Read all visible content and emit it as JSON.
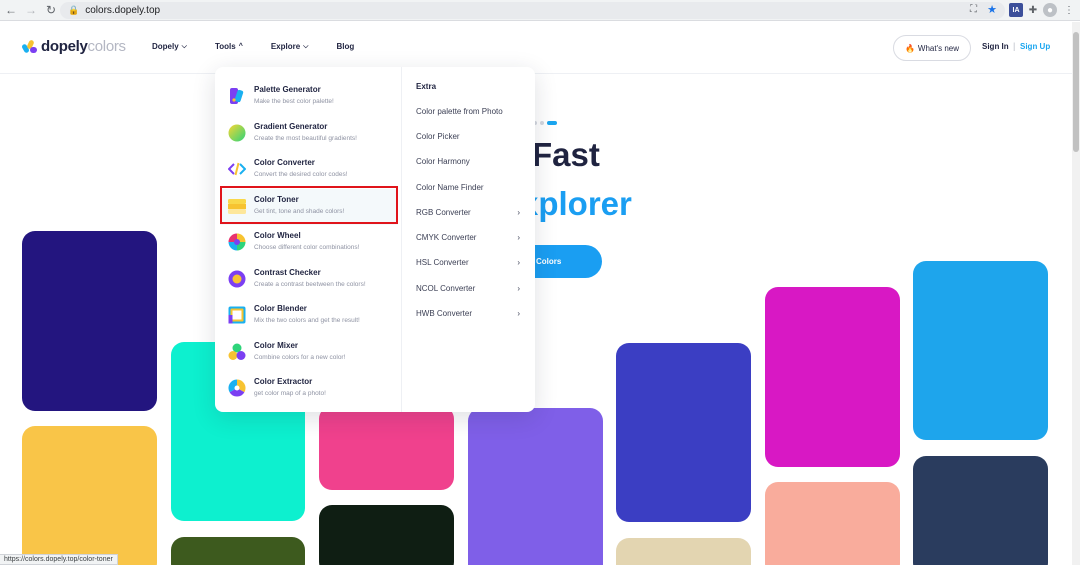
{
  "browser": {
    "url": "colors.dopely.top",
    "status_url": "https://colors.dopely.top/color-toner"
  },
  "header": {
    "logo_part1": "dopely",
    "logo_part2": "colors",
    "nav": [
      {
        "label": "Dopely",
        "chevron": "down"
      },
      {
        "label": "Tools",
        "chevron": "up"
      },
      {
        "label": "Explore",
        "chevron": "down"
      },
      {
        "label": "Blog"
      }
    ],
    "whats_new": "What's new",
    "sign_in": "Sign In",
    "separator": "|",
    "sign_up": "Sign Up"
  },
  "hero": {
    "line1": "r Fast",
    "line2": "xplorer",
    "button": "Colors"
  },
  "dropdown": {
    "tools": [
      {
        "name": "Palette Generator",
        "desc": "Make the best color palette!",
        "icon": "palette-icon"
      },
      {
        "name": "Gradient Generator",
        "desc": "Create the most beautiful gradients!",
        "icon": "gradient-icon"
      },
      {
        "name": "Color Converter",
        "desc": "Convert the desired color codes!",
        "icon": "code-icon"
      },
      {
        "name": "Color Toner",
        "desc": "Get tint, tone and shade colors!",
        "icon": "toner-icon"
      },
      {
        "name": "Color Wheel",
        "desc": "Choose different color combinations!",
        "icon": "wheel-icon"
      },
      {
        "name": "Contrast Checker",
        "desc": "Create a contrast beetween the colors!",
        "icon": "contrast-icon"
      },
      {
        "name": "Color Blender",
        "desc": "Mix the two colors and get the result!",
        "icon": "blender-icon"
      },
      {
        "name": "Color Mixer",
        "desc": "Combine colors for a new color!",
        "icon": "mixer-icon"
      },
      {
        "name": "Color Extractor",
        "desc": "get color map of a photo!",
        "icon": "extractor-icon"
      }
    ],
    "extra_title": "Extra",
    "extra_links": [
      {
        "label": "Color palette from Photo",
        "arrow": ""
      },
      {
        "label": "Color Picker",
        "arrow": ""
      },
      {
        "label": "Color Harmony",
        "arrow": ""
      },
      {
        "label": "Color Name Finder",
        "arrow": ""
      },
      {
        "label": "RGB Converter",
        "arrow": "›"
      },
      {
        "label": "CMYK Converter",
        "arrow": "›"
      },
      {
        "label": "HSL Converter",
        "arrow": "›"
      },
      {
        "label": "NCOL Converter",
        "arrow": "›"
      },
      {
        "label": "HWB Converter",
        "arrow": "›"
      }
    ]
  },
  "cards": [
    {
      "color": "#23157f"
    },
    {
      "color": "#f9c548"
    },
    {
      "color": "#0df0cf"
    },
    {
      "color": "#3d5a1e"
    },
    {
      "color": "#f0418d"
    },
    {
      "color": "#0f1e13"
    },
    {
      "color": "#7f5fe8"
    },
    {
      "color": "#3b3ec3"
    },
    {
      "color": "#e3d5b1"
    },
    {
      "color": "#d818c4"
    },
    {
      "color": "#f9ac9c"
    },
    {
      "color": "#1ea5ec"
    },
    {
      "color": "#2a3c5e"
    }
  ]
}
